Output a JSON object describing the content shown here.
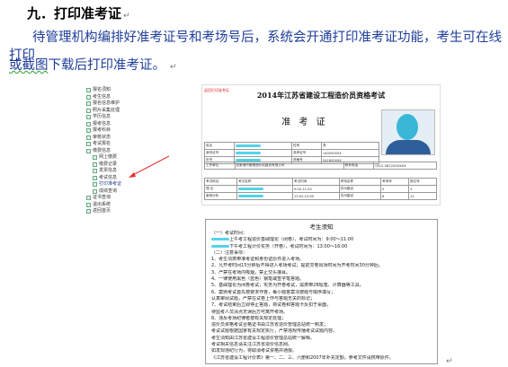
{
  "doc": {
    "heading": "九．打印准考证",
    "para1": "待管理机构编排好准考证号和考场号后，系统会开通打印准考证功能，考生可在线打印",
    "para2_squiggle": "或截图",
    "para2_rest": "下载后打印准考证。"
  },
  "tree": [
    {
      "label": "报名须知",
      "sub": false
    },
    {
      "label": "考生信息",
      "sub": false
    },
    {
      "label": "报名信息维护",
      "sub": false
    },
    {
      "label": "照片采集处理",
      "sub": false
    },
    {
      "label": "学历信息",
      "sub": false
    },
    {
      "label": "报考信息",
      "sub": false
    },
    {
      "label": "报考科目",
      "sub": false
    },
    {
      "label": "审核状态",
      "sub": false
    },
    {
      "label": "考试报名",
      "sub": false
    },
    {
      "label": "缴费信息",
      "sub": false
    },
    {
      "label": "网上缴费",
      "sub": true
    },
    {
      "label": "缴费记录",
      "sub": true
    },
    {
      "label": "发票信息",
      "sub": true
    },
    {
      "label": "考试信息",
      "sub": true
    },
    {
      "label": "打印准考证",
      "sub": true,
      "highlight": true
    },
    {
      "label": "成绩查询",
      "sub": true
    },
    {
      "label": "证书查询",
      "sub": false
    },
    {
      "label": "退出系统",
      "sub": false
    },
    {
      "label": "返回首页",
      "sub": false
    }
  ],
  "ticket": {
    "corner_link": "返回打印准考证",
    "title": "2014年江苏省建设工程造价员资格考试",
    "label": "准 考 证",
    "info_rows": [
      [
        "姓名",
        "",
        "性别",
        "男"
      ],
      [
        "身份证号",
        "",
        "准考证号",
        "14050000X"
      ],
      [
        "年号",
        "",
        "资格号",
        "54160000X"
      ]
    ],
    "org_row": [
      "工作单位",
      "张家港市管理造价站建设有限公司",
      "联系电话",
      "0512-5822XXXXXX"
    ],
    "exam_header": [
      "考试科目",
      "考试名称",
      "考试时间",
      "考场名称",
      "考场号",
      "座位号"
    ],
    "exam_rows": [
      [
        "理 论",
        "",
        "9:00-11:00",
        "苏州建设",
        "5",
        "3"
      ],
      [
        "案例分析",
        "",
        "13:00-15:00",
        "苏州建设",
        "6",
        "12"
      ]
    ]
  },
  "notice": {
    "title": "考生须知",
    "lines": [
      "（一）考试时间：",
      "上午考工程造价基础理论（闭卷），考试时间为：9:00～11:00",
      "下午考工程计价实务（开卷），考试时间为：13:00～16:00",
      "（二）注意事项：",
      "1、考生须携带准考证和身份证原件进入考场。",
      "2、凡开考时间15分钟后不得进入考场考试；提前交卷出场时间为开考时间30分钟后。",
      "3、严禁在考场内吸烟，禁止交头接耳。",
      "4、一律使用黑色（蓝色）钢笔或签字笔答题。",
      "5、基础理论为闭卷考试；实务为开卷考试，需携带2B铅笔、计算器等工具。",
      "6、案例考试首先按要求作答，每小题答案须按题号顺序填写；",
      "认真审阅试题，严禁在试卷上作与答题无关的标记；",
      "7、考试结束后立即停止答题，将试卷和答题卡反扣于桌面，",
      "待监考人员清点无误后方可离开考场。",
      "8、违反考场纪律者按有关规定处理；",
      "造价员资格考试合格证书由江苏省造价管理总站统一制发；",
      "考试试题根据国家有关规定执行，严禁违规传播考试试题内容。",
      "考生须知由江苏省建设工程造价管理总站统一解释。",
      "考试相关信息请关注江苏省造价信息网。",
      "如发现违纪行为，将取消考试资格并通报。",
      "《江苏省建设工程计价表》第一、二、三、六册和2007年补充定额，参考文件请携带原件。"
    ]
  }
}
